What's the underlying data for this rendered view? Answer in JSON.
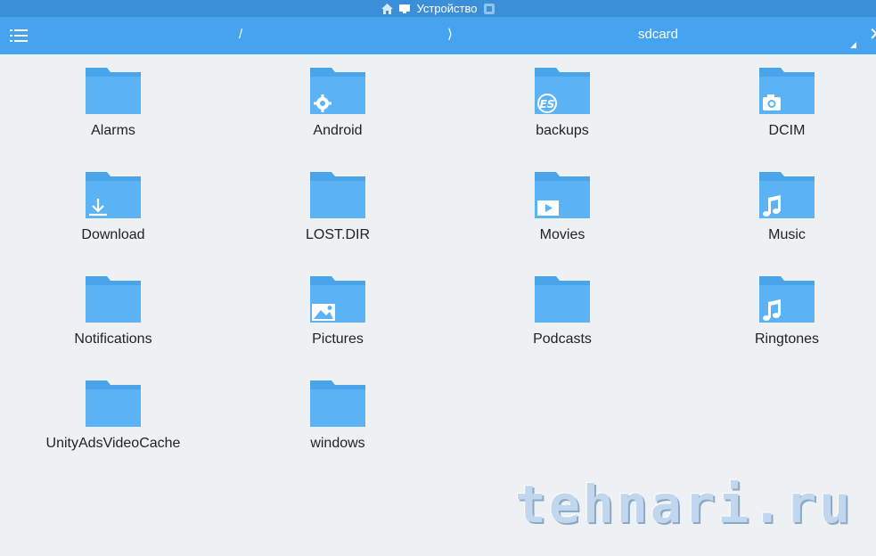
{
  "topbar": {
    "title": "Устройство",
    "home_icon": "home-icon",
    "tab_icon": "device-tab-icon"
  },
  "toolbar": {
    "path_root": "/",
    "path_separator": "⟩",
    "path_current": "sdcard",
    "menu_icon": "menu-list-icon",
    "close_icon": "close-icon"
  },
  "folders": [
    {
      "label": "Alarms",
      "badge": ""
    },
    {
      "label": "Android",
      "badge": "gear"
    },
    {
      "label": "backups",
      "badge": "es"
    },
    {
      "label": "DCIM",
      "badge": "camera"
    },
    {
      "label": "Download",
      "badge": "download"
    },
    {
      "label": "LOST.DIR",
      "badge": ""
    },
    {
      "label": "Movies",
      "badge": "play"
    },
    {
      "label": "Music",
      "badge": "note"
    },
    {
      "label": "Notifications",
      "badge": ""
    },
    {
      "label": "Pictures",
      "badge": "image"
    },
    {
      "label": "Podcasts",
      "badge": ""
    },
    {
      "label": "Ringtones",
      "badge": "note"
    },
    {
      "label": "UnityAdsVideoCache",
      "badge": ""
    },
    {
      "label": "windows",
      "badge": ""
    }
  ],
  "watermark": "tehnari.ru",
  "colors": {
    "topbar": "#3b8fd8",
    "toolbar": "#45a3f0",
    "folder_front": "#5bb3f5",
    "folder_back": "#4aa4ea",
    "background": "#eef1f4"
  }
}
